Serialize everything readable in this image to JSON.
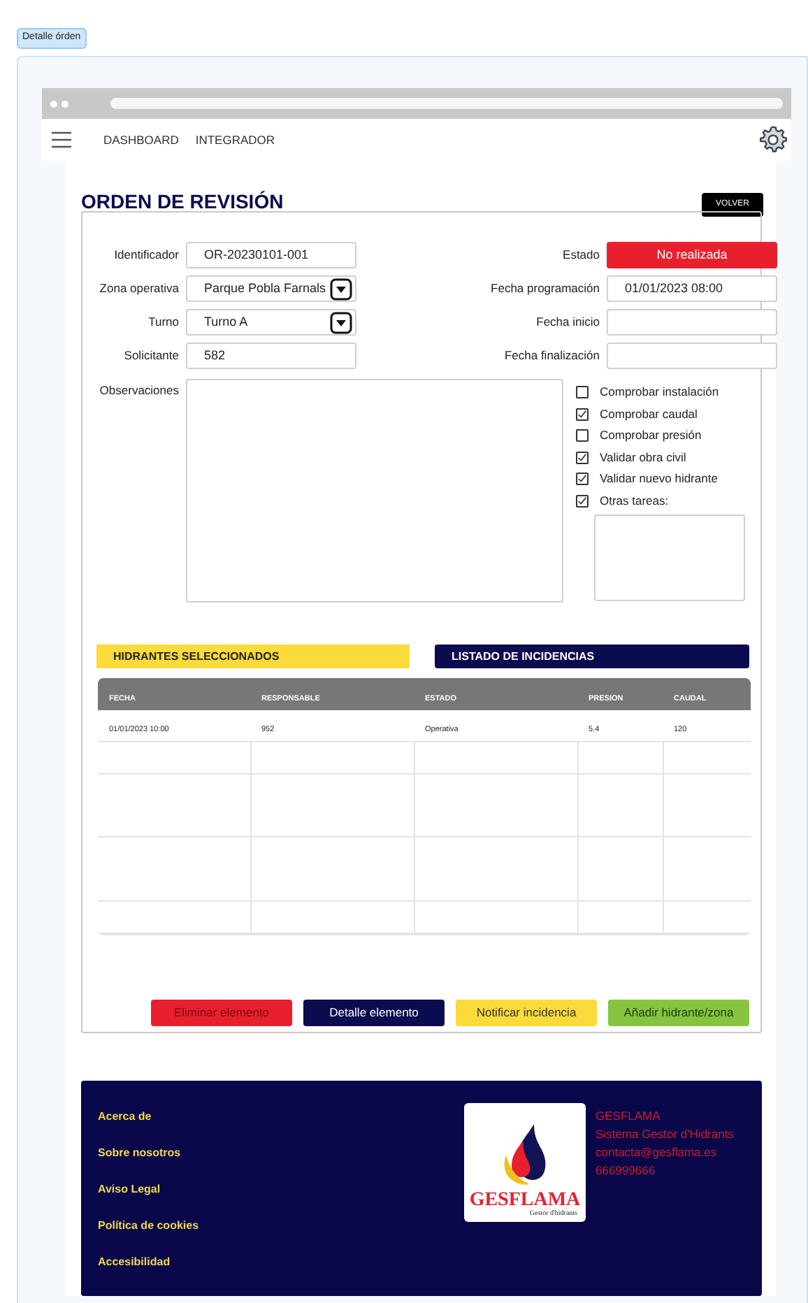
{
  "page_tag": "Detalle órden",
  "nav": {
    "items": [
      "DASHBOARD",
      "INTEGRADOR"
    ]
  },
  "title": "ORDEN DE REVISIÓN",
  "back_button": "VOLVER",
  "left_fields": [
    {
      "label": "Identificador",
      "value": "OR-20230101-001",
      "kind": "text"
    },
    {
      "label": "Zona operativa",
      "value": "Parque Pobla Farnals",
      "kind": "select"
    },
    {
      "label": "Turno",
      "value": "Turno A",
      "kind": "select"
    },
    {
      "label": "Solicitante",
      "value": "582",
      "kind": "text"
    }
  ],
  "right_fields": [
    {
      "label": "Estado",
      "value": "No realizada",
      "kind": "status"
    },
    {
      "label": "Fecha programación",
      "value": "01/01/2023 08:00",
      "kind": "text"
    },
    {
      "label": "Fecha inicio",
      "kind": "text"
    },
    {
      "label": "Fecha finalización",
      "kind": "text"
    }
  ],
  "observations_label": "Observaciones",
  "tasks": [
    {
      "label": "Comprobar instalación",
      "checked": false
    },
    {
      "label": "Comprobar caudal",
      "checked": true
    },
    {
      "label": "Comprobar presión",
      "checked": false
    },
    {
      "label": "Validar obra civil",
      "checked": true
    },
    {
      "label": "Validar nuevo hidrante",
      "checked": true
    },
    {
      "label": "Otras tareas:",
      "checked": true
    }
  ],
  "sections": [
    {
      "label": "HIDRANTES SELECCIONADOS",
      "selected": false
    },
    {
      "label": "LISTADO DE INCIDENCIAS",
      "selected": true
    }
  ],
  "table": {
    "columns": [
      "FECHA",
      "RESPONSABLE",
      "ESTADO",
      "PRESION",
      "CAUDAL"
    ],
    "rows": [
      [
        "01/01/2023 10:00",
        "952",
        "Operativa",
        "5.4",
        "120"
      ]
    ]
  },
  "actions": [
    {
      "label": "Eliminar elemento",
      "kind": "danger"
    },
    {
      "label": "Detalle elemento",
      "kind": "primary"
    },
    {
      "label": "Notificar incidencia",
      "kind": "warning"
    },
    {
      "label": "Añadir hidrante/zona",
      "kind": "success"
    }
  ],
  "footer": {
    "links": [
      "Acerca de",
      "Sobre nosotros",
      "Aviso Legal",
      "Política de cookies",
      "Accesibilidad"
    ],
    "logo": {
      "name": "GESFLAMA",
      "tagline": "Gestor d'hidrants"
    },
    "info": [
      "GESFLAMA",
      "Sistema Gestor d'Hidrants",
      "contacta@gesflama.es",
      "666999666"
    ]
  }
}
